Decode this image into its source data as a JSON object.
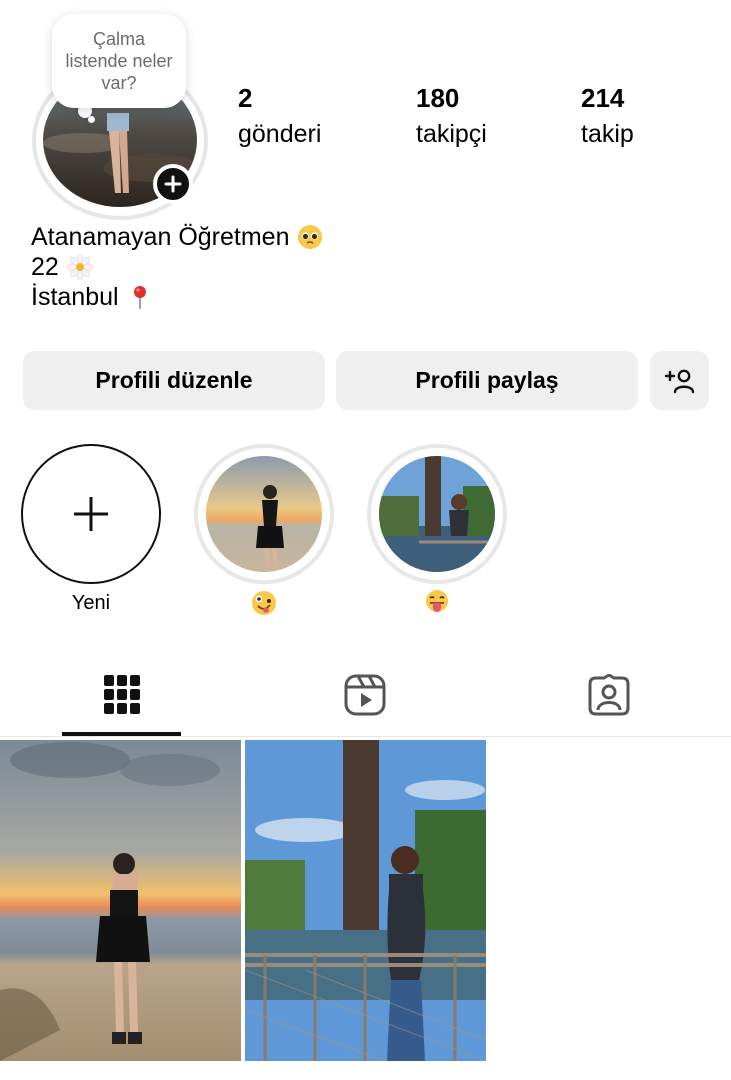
{
  "profile": {
    "note_text": "Çalma listende neler var?",
    "stats": [
      {
        "value": "2",
        "label": "gönderi"
      },
      {
        "value": "180",
        "label": "takipçi"
      },
      {
        "value": "214",
        "label": "takip"
      }
    ],
    "bio": {
      "name": "Atanamayan Öğretmen",
      "line2": "22",
      "line3": "İstanbul"
    }
  },
  "actions": {
    "edit_label": "Profili düzenle",
    "share_label": "Profili paylaş",
    "add_person_icon": "add-person-icon"
  },
  "highlights": [
    {
      "label": "Yeni",
      "type": "new"
    },
    {
      "emoji": "zany-face",
      "type": "story"
    },
    {
      "emoji": "tongue-face",
      "type": "story"
    }
  ],
  "tabs": [
    {
      "icon": "grid-icon",
      "active": true
    },
    {
      "icon": "reels-icon",
      "active": false
    },
    {
      "icon": "tagged-icon",
      "active": false
    }
  ],
  "colors": {
    "button_bg": "#efefef",
    "ring": "#e6e6e6",
    "text": "#000000",
    "note_text": "#6b6b6b"
  }
}
